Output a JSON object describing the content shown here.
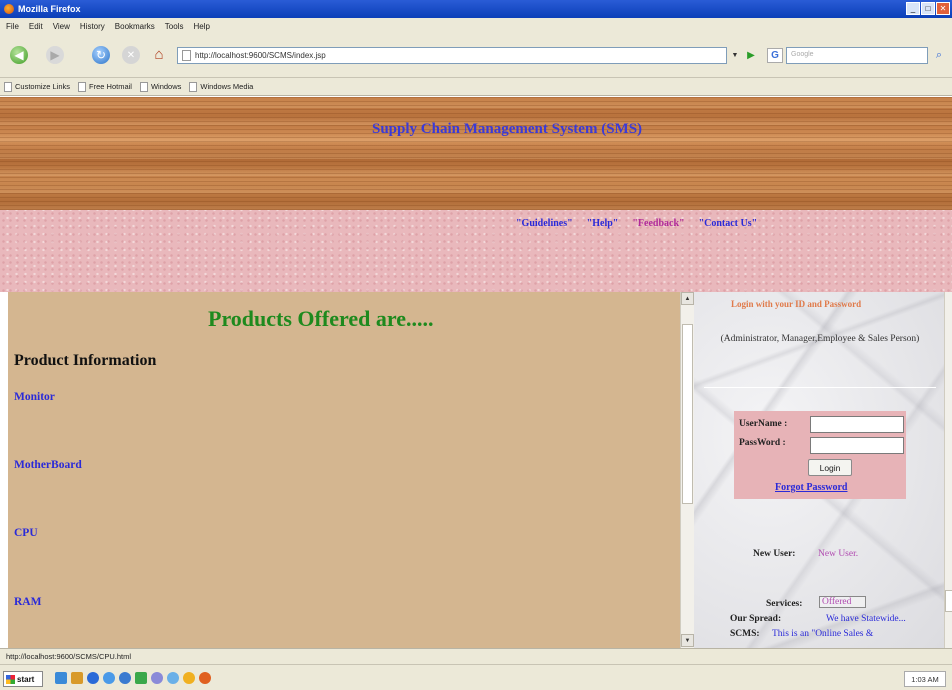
{
  "window": {
    "title": "Mozilla Firefox"
  },
  "menu": [
    "File",
    "Edit",
    "View",
    "History",
    "Bookmarks",
    "Tools",
    "Help"
  ],
  "nav": {
    "url": "http://localhost:9600/SCMS/index.jsp",
    "search_placeholder": "Google",
    "search_engine_letter": "G"
  },
  "bookmarks": [
    "Customize Links",
    "Free Hotmail",
    "Windows",
    "Windows Media"
  ],
  "site": {
    "title": "Supply Chain Management System (SMS)",
    "top_links": [
      {
        "label": "\"Guidelines\"",
        "color": "#2a2ad8"
      },
      {
        "label": "\"Help\"",
        "color": "#2a2ad8"
      },
      {
        "label": "\"Feedback\"",
        "color": "#b02a9a"
      },
      {
        "label": "\"Contact Us\"",
        "color": "#2a2ad8"
      }
    ]
  },
  "main": {
    "heading": "Products Offered are.....",
    "subheading": "Product Information",
    "products": [
      "Monitor",
      "MotherBoard",
      "CPU",
      "RAM"
    ]
  },
  "sidebar": {
    "login_prompt": "Login with your ID and Password",
    "roles": "(Administrator, Manager,Employee & Sales Person)",
    "username_label": "UserName :",
    "password_label": "PassWord :",
    "login_button": "Login",
    "forgot_password": "Forgot Password",
    "new_user_label": "New User:",
    "new_user_link": "New User.",
    "services_label": "Services:",
    "services_link": "Offered",
    "spread_label": "Our Spread:",
    "spread_text": "We have Statewide...",
    "scms_label": "SCMS:",
    "scms_text": "This is an \"Online Sales &"
  },
  "status": {
    "text": "http://localhost:9600/SCMS/CPU.html"
  },
  "taskbar": {
    "start_label": "start",
    "clock": "1:03 AM"
  }
}
